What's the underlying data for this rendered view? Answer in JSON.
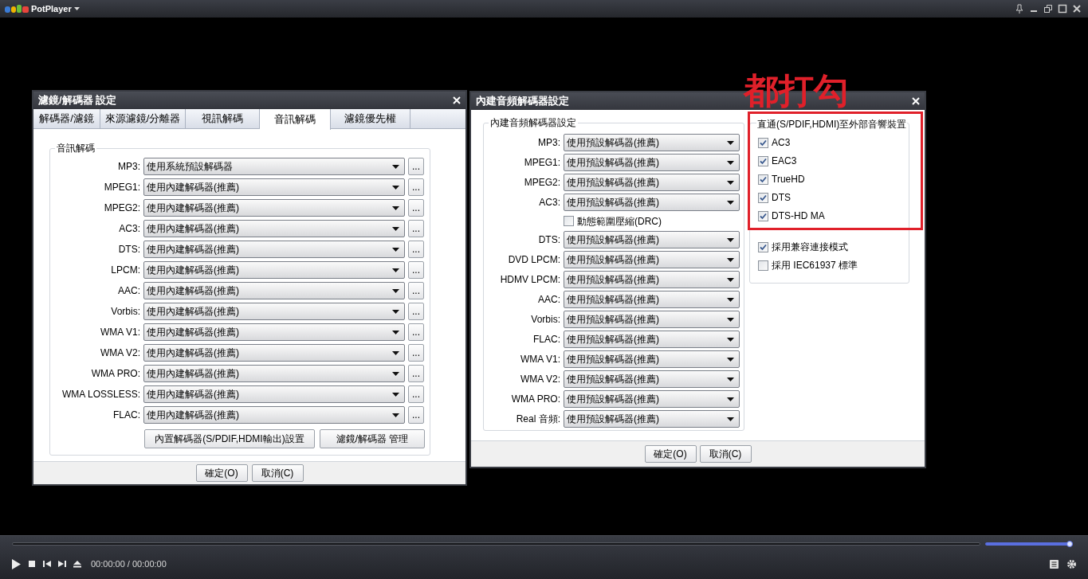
{
  "app": {
    "title": "PotPlayer"
  },
  "filter_dialog": {
    "title": "濾鏡/解碼器 設定",
    "tabs": [
      {
        "label": "解碼器/濾鏡",
        "selected": false
      },
      {
        "label": "來源濾鏡/分離器",
        "selected": false
      },
      {
        "label": "視訊解碼",
        "selected": false
      },
      {
        "label": "音訊解碼",
        "selected": true
      },
      {
        "label": "濾鏡優先權",
        "selected": false
      }
    ],
    "group_title": "音訊解碼",
    "rows": [
      {
        "label": "MP3:",
        "value": "使用系統預設解碼器",
        "more": "..."
      },
      {
        "label": "MPEG1:",
        "value": "使用內建解碼器(推薦)",
        "more": "..."
      },
      {
        "label": "MPEG2:",
        "value": "使用內建解碼器(推薦)",
        "more": "..."
      },
      {
        "label": "AC3:",
        "value": "使用內建解碼器(推薦)",
        "more": "..."
      },
      {
        "label": "DTS:",
        "value": "使用內建解碼器(推薦)",
        "more": "..."
      },
      {
        "label": "LPCM:",
        "value": "使用內建解碼器(推薦)",
        "more": "..."
      },
      {
        "label": "AAC:",
        "value": "使用內建解碼器(推薦)",
        "more": "..."
      },
      {
        "label": "Vorbis:",
        "value": "使用內建解碼器(推薦)",
        "more": "..."
      },
      {
        "label": "WMA V1:",
        "value": "使用內建解碼器(推薦)",
        "more": "..."
      },
      {
        "label": "WMA V2:",
        "value": "使用內建解碼器(推薦)",
        "more": "..."
      },
      {
        "label": "WMA PRO:",
        "value": "使用內建解碼器(推薦)",
        "more": "..."
      },
      {
        "label": "WMA LOSSLESS:",
        "value": "使用內建解碼器(推薦)",
        "more": "..."
      },
      {
        "label": "FLAC:",
        "value": "使用內建解碼器(推薦)",
        "more": "..."
      }
    ],
    "buttons": [
      "內置解碼器(S/PDIF,HDMI輸出)設置",
      "濾鏡/解碼器 管理"
    ],
    "footer_buttons": [
      "確定(O)",
      "取消(C)"
    ]
  },
  "audio_dialog": {
    "title": "內建音頻解碼器設定",
    "group_title": "內建音頻解碼器設定",
    "rows": [
      {
        "kind": "combo",
        "label": "MP3:",
        "value": "使用預設解碼器(推薦)"
      },
      {
        "kind": "combo",
        "label": "MPEG1:",
        "value": "使用預設解碼器(推薦)"
      },
      {
        "kind": "combo",
        "label": "MPEG2:",
        "value": "使用預設解碼器(推薦)"
      },
      {
        "kind": "combo",
        "label": "AC3:",
        "value": "使用預設解碼器(推薦)"
      },
      {
        "kind": "checkbox",
        "label": "動態範圍壓縮(DRC)",
        "checked": false
      },
      {
        "kind": "combo",
        "label": "DTS:",
        "value": "使用預設解碼器(推薦)"
      },
      {
        "kind": "combo",
        "label": "DVD LPCM:",
        "value": "使用預設解碼器(推薦)"
      },
      {
        "kind": "combo",
        "label": "HDMV LPCM:",
        "value": "使用預設解碼器(推薦)"
      },
      {
        "kind": "combo",
        "label": "AAC:",
        "value": "使用預設解碼器(推薦)"
      },
      {
        "kind": "combo",
        "label": "Vorbis:",
        "value": "使用預設解碼器(推薦)"
      },
      {
        "kind": "combo",
        "label": "FLAC:",
        "value": "使用預設解碼器(推薦)"
      },
      {
        "kind": "combo",
        "label": "WMA V1:",
        "value": "使用預設解碼器(推薦)"
      },
      {
        "kind": "combo",
        "label": "WMA V2:",
        "value": "使用預設解碼器(推薦)"
      },
      {
        "kind": "combo",
        "label": "WMA PRO:",
        "value": "使用預設解碼器(推薦)"
      },
      {
        "kind": "combo",
        "label": "Real 音頻:",
        "value": "使用預設解碼器(推薦)"
      }
    ],
    "passthrough": {
      "title": "直通(S/PDIF,HDMI)至外部音響裝置",
      "options": [
        {
          "label": "AC3",
          "checked": true
        },
        {
          "label": "EAC3",
          "checked": true
        },
        {
          "label": "TrueHD",
          "checked": true
        },
        {
          "label": "DTS",
          "checked": true
        },
        {
          "label": "DTS-HD MA",
          "checked": true
        }
      ]
    },
    "extra_options": [
      {
        "label": "採用兼容連接模式",
        "checked": true
      },
      {
        "label": "採用 IEC61937 標準",
        "checked": false
      }
    ],
    "footer_buttons": [
      "確定(O)",
      "取消(C)"
    ]
  },
  "annotation": {
    "text": "都打勾"
  },
  "player": {
    "time": "00:00:00 / 00:00:00",
    "volume": {
      "level": 1
    }
  }
}
